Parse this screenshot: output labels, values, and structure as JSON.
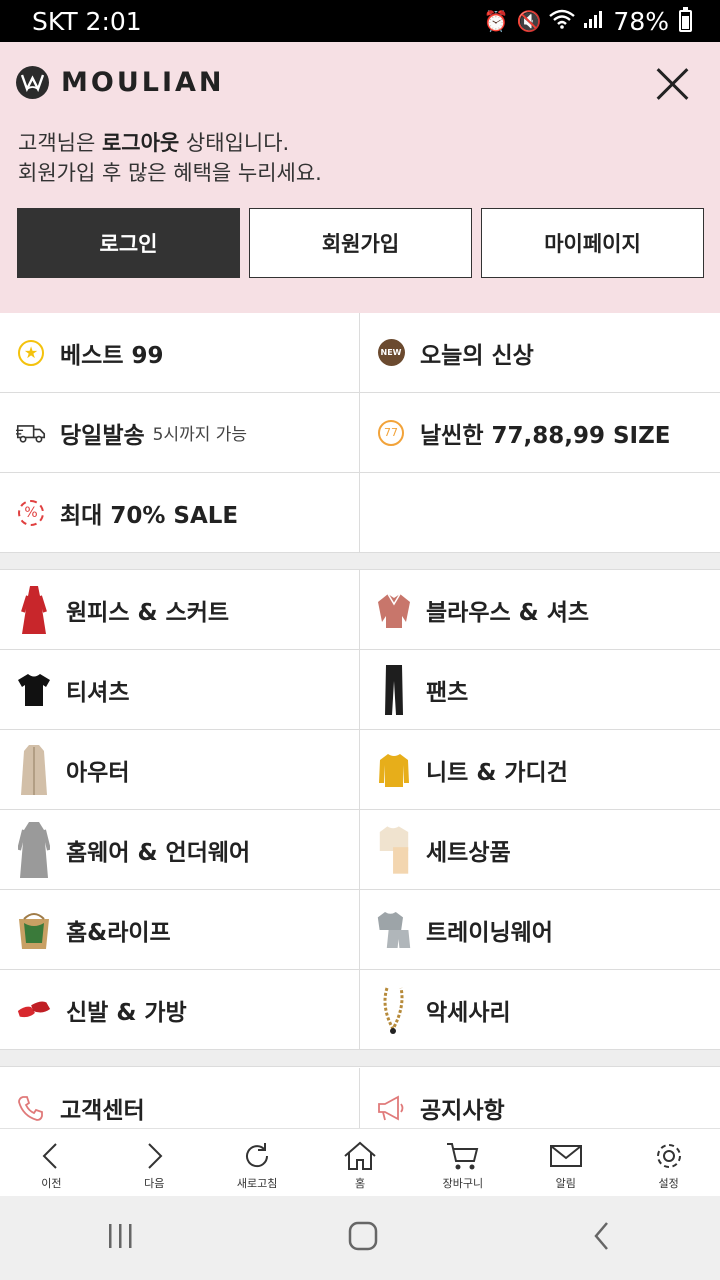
{
  "status_bar": {
    "carrier_time": "SKT 2:01",
    "battery": "78%",
    "icons": [
      "alarm-icon",
      "mute-icon",
      "wifi-icon",
      "signal-icon",
      "battery-icon"
    ]
  },
  "header": {
    "brand": "MOULIAN",
    "msg_prefix": "고객님은 ",
    "msg_bold": "로그아웃",
    "msg_suffix": " 상태입니다.",
    "msg_line2": "회원가입 후 많은 혜택을 누리세요.",
    "buttons": {
      "login": "로그인",
      "signup": "회원가입",
      "mypage": "마이페이지"
    }
  },
  "quick_links": [
    {
      "label": "베스트 99",
      "icon": "star-icon"
    },
    {
      "label": "오늘의 신상",
      "icon": "new-badge-icon",
      "badge": "NEW"
    },
    {
      "label": "당일발송",
      "sub": "5시까지 가능",
      "icon": "delivery-truck-icon"
    },
    {
      "label": "날씬한 77,88,99 SIZE",
      "icon": "size-77-icon",
      "badge": "77"
    },
    {
      "label": "최대 70% SALE",
      "icon": "sale-badge-icon"
    }
  ],
  "categories": [
    {
      "label": "원피스 & 스커트",
      "thumb": "red-dress-thumb"
    },
    {
      "label": "블라우스 & 셔츠",
      "thumb": "blouse-thumb"
    },
    {
      "label": "티셔츠",
      "thumb": "tshirt-thumb"
    },
    {
      "label": "팬츠",
      "thumb": "pants-thumb"
    },
    {
      "label": "아우터",
      "thumb": "coat-thumb"
    },
    {
      "label": "니트 & 가디건",
      "thumb": "knit-thumb"
    },
    {
      "label": "홈웨어 & 언더웨어",
      "thumb": "homewear-thumb"
    },
    {
      "label": "세트상품",
      "thumb": "set-thumb"
    },
    {
      "label": "홈&라이프",
      "thumb": "basket-thumb"
    },
    {
      "label": "트레이닝웨어",
      "thumb": "training-thumb"
    },
    {
      "label": "신발 & 가방",
      "thumb": "shoes-thumb"
    },
    {
      "label": "악세사리",
      "thumb": "necklace-thumb"
    }
  ],
  "support": [
    {
      "label": "고객센터",
      "icon": "phone-icon"
    },
    {
      "label": "공지사항",
      "icon": "megaphone-icon"
    }
  ],
  "toolbar": {
    "back": "이전",
    "forward": "다음",
    "refresh": "새로고침",
    "home": "홈",
    "cart": "장바구니",
    "notify": "알림",
    "settings": "설정"
  },
  "colors": {
    "header_bg": "#f6e0e4",
    "dark_button": "#333333",
    "accent_red": "#e04040"
  }
}
